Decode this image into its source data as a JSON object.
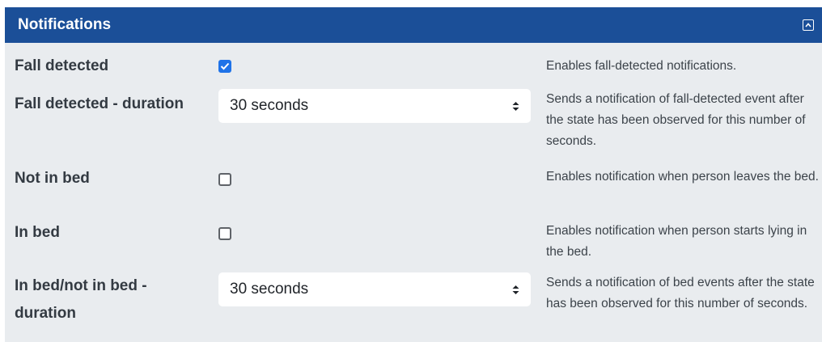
{
  "panel": {
    "title": "Notifications"
  },
  "rows": [
    {
      "label": "Fall detected",
      "control": "checkbox",
      "checked": true,
      "description": "Enables fall-detected notifications."
    },
    {
      "label": "Fall detected - duration",
      "control": "select",
      "value": "30 seconds",
      "description": "Sends a notification of fall-detected event after the state has been observed for this number of seconds."
    },
    {
      "label": "Not in bed",
      "control": "checkbox",
      "checked": false,
      "description": "Enables notification when person leaves the bed."
    },
    {
      "label": "In bed",
      "control": "checkbox",
      "checked": false,
      "description": "Enables notification when person starts lying in the bed."
    },
    {
      "label": "In bed/not in bed - duration",
      "control": "select",
      "value": "30 seconds",
      "description": "Sends a notification of bed events after the state has been observed for this number of seconds."
    }
  ],
  "icons": {
    "collapse": "collapse-icon",
    "checkmark": "checkmark-icon",
    "select_arrows": "updown-arrows-icon"
  },
  "colors": {
    "header": "#1b4f98",
    "panel_bg": "#e9ecef",
    "checkbox_checked": "#1f73e8"
  }
}
